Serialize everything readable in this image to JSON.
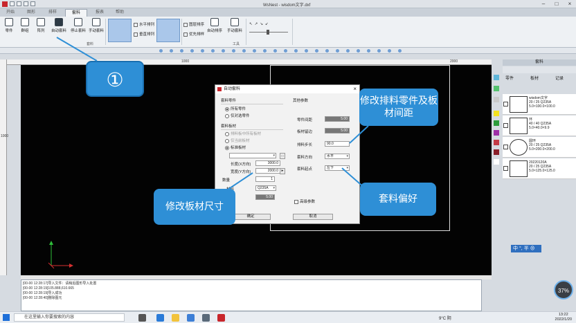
{
  "window": {
    "title": "WsNest - wisdom文字.dxf"
  },
  "tabs": [
    "开始",
    "图形",
    "排样",
    "套料",
    "报表",
    "帮助"
  ],
  "active_tab": "套料",
  "ribbon": {
    "buttons": [
      "零件",
      "群组",
      "阵列",
      "自动套料",
      "停止套料",
      "手动套料"
    ],
    "small_items": [
      "水平排列",
      "垂直排列",
      "自动排序",
      "图层排序",
      "优先排样"
    ],
    "group_labels": [
      "套料",
      "工具"
    ]
  },
  "rulers": {
    "top_ticks": [
      "1000",
      "2000"
    ],
    "left_ticks": [
      "1000"
    ]
  },
  "dialog": {
    "title": "自动套料",
    "section_parts": "套料零件",
    "parts_all": "所有零件",
    "parts_selected": "仅对选零件",
    "section_plate": "套料板材",
    "plate_opt1": "排料板中所有板材",
    "plate_opt2": "仅当前板材",
    "plate_std": "标准板材",
    "length_label": "长度(X方向)",
    "length_value": "3000.0",
    "width_label": "宽度(Y方向)",
    "width_value": "2000.0",
    "qty_label": "数量",
    "qty_value": "1",
    "material_label": "材料",
    "material_value": "Q235A",
    "thickness_value": "5.00",
    "section_other": "其他参数",
    "gap_label": "零件间距",
    "gap_value": "5.00",
    "margin_label": "板材留边",
    "margin_value": "5.00",
    "step_label": "排料步长",
    "step_value": "90.0",
    "dir_label": "套料方向",
    "dir_value": "水平",
    "start_label": "套料起点",
    "start_value": "左下",
    "advanced_label": "高级参数",
    "ok": "确定",
    "cancel": "取消"
  },
  "callouts": {
    "step": "①",
    "parts_gap": "修改排料零件及板材间距",
    "plate_size": "修改板材尺寸",
    "preference": "套料偏好"
  },
  "right_panel": {
    "title": "套料",
    "tabs": [
      "零件",
      "板材",
      "记录"
    ],
    "parts": [
      {
        "name": "wisdom文字",
        "line1": "20 / 25 Q235A",
        "line2": "5.0×100.0×100.0"
      },
      {
        "name": "环",
        "line1": "40 / 40 Q235A",
        "line2": "5.0×40.0×9.9"
      },
      {
        "name": "圆环",
        "line1": "20 / 25 Q235A",
        "line2": "5.0×200.0×200.0"
      },
      {
        "name": "20220120A",
        "line1": "20 / 25 Q235A",
        "line2": "5.0×125.0×125.0"
      }
    ],
    "swatch_colors": [
      "#5fb6d9",
      "#56c26f",
      "#c9c9c9",
      "#f2e11f",
      "#2c9b3a",
      "#9e2fa6",
      "#c23b47",
      "#8a1f2a",
      "#ffffff"
    ]
  },
  "log": [
    "[00-00 12:28:17]导入文件：请稍后图形导入处置",
    "[00-00 12:28:19]105.888,610.665",
    "[00-00 12:28:19]导入成功",
    "[00-00 12:28:40]删除图元"
  ],
  "taskbar": {
    "search_placeholder": "在这里输入你要搜索的内容",
    "weather": "9°C 阴",
    "time": "13:22",
    "date": "2022/1/20"
  },
  "ime": {
    "label": "中 °, 半 ⊕"
  },
  "perf": {
    "value": "37%"
  }
}
